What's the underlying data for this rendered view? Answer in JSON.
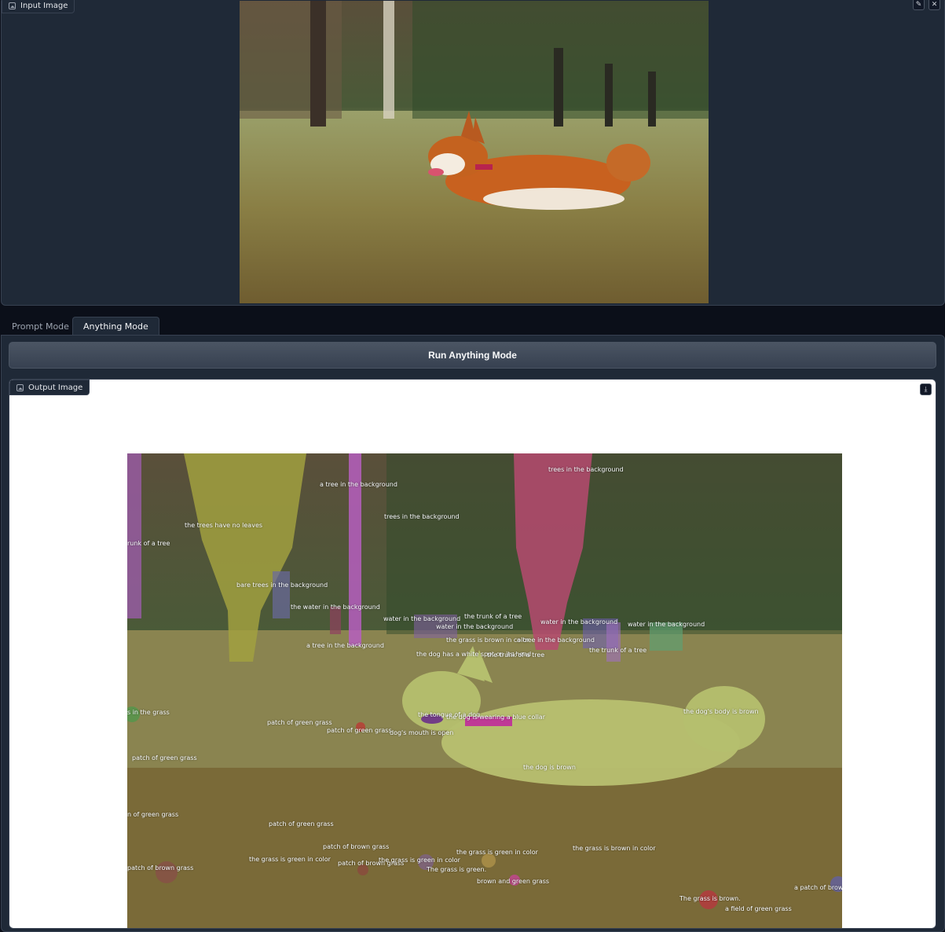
{
  "input_panel": {
    "label": "Input Image",
    "edit_icon": "pencil-icon",
    "close_icon": "close-icon",
    "image_icon": "image-icon"
  },
  "tabs": [
    {
      "label": "Prompt Mode",
      "active": false
    },
    {
      "label": "Anything Mode",
      "active": true
    }
  ],
  "run_button": {
    "label": "Run Anything Mode"
  },
  "output_panel": {
    "label": "Output Image",
    "image_icon": "image-icon",
    "download_icon": "download-icon",
    "segment_labels": [
      "trees in the background",
      "a tree in the background",
      "trees in the background",
      "the trees have no leaves",
      "runk of a tree",
      "bare trees in the background",
      "the water in the background",
      "water in the background",
      "the trunk of a tree",
      "water in the background",
      "water in the background",
      "water in the background",
      "the grass is brown in color",
      "a tree in the background",
      "a tree in the background",
      "the trunk of a tree",
      "the dog has a white spot on its head",
      "the trunk of a tree",
      "s in the grass",
      "the dog's body is brown",
      "the tongue of a dog",
      "the dog is wearing a blue collar",
      "patch of green grass",
      "patch of green grass",
      "dog's mouth is open",
      "patch of green grass",
      "the dog is brown",
      "n of green grass",
      "patch of green grass",
      "patch of brown grass",
      "the grass is green in color",
      "the grass is brown in color",
      "the grass is green in color",
      "patch of brown grass",
      "the grass is green in color",
      "patch of brown grass",
      "The grass is green.",
      "brown and green grass",
      "a patch of brow",
      "The grass is brown.",
      "a field of green grass"
    ]
  }
}
